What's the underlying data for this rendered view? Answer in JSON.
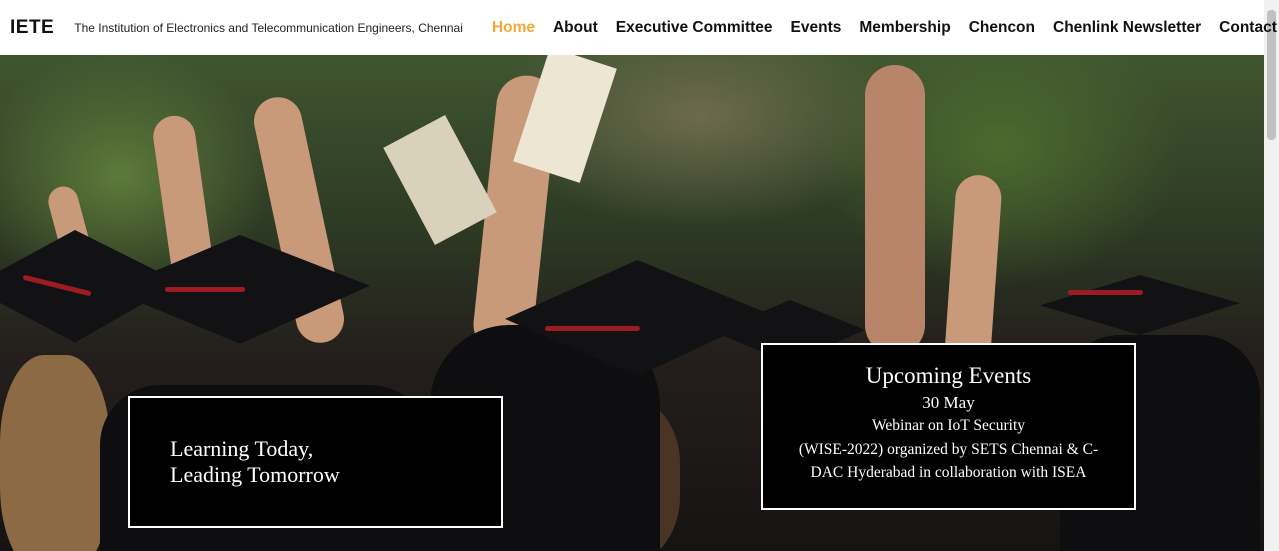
{
  "header": {
    "brand": "IETE",
    "subtitle": "The Institution of Electronics and Telecommunication Engineers, Chennai",
    "nav": [
      {
        "label": "Home",
        "active": true
      },
      {
        "label": "About"
      },
      {
        "label": "Executive Committee"
      },
      {
        "label": "Events"
      },
      {
        "label": "Membership"
      },
      {
        "label": "Chencon"
      },
      {
        "label": "Chenlink Newsletter"
      },
      {
        "label": "Contact"
      }
    ],
    "active_color": "#f6a93b"
  },
  "hero": {
    "tagline": [
      "Learning Today,",
      "Leading Tomorrow"
    ],
    "events": {
      "title": "Upcoming Events",
      "date": "30 May",
      "lines": [
        "Webinar on IoT Security",
        "(WISE-2022) organized by SETS Chennai & C-",
        "DAC Hyderabad in collaboration with ISEA"
      ]
    }
  }
}
